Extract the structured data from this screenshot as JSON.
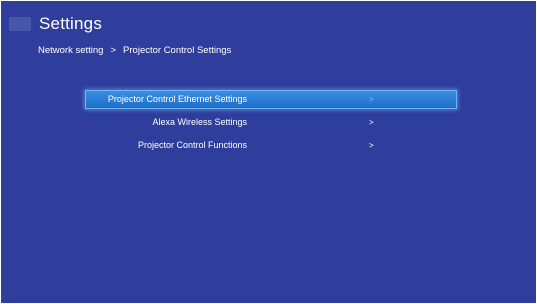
{
  "header": {
    "title": "Settings"
  },
  "breadcrumb": {
    "parent": "Network setting",
    "separator": ">",
    "current": "Projector Control Settings"
  },
  "menu": {
    "items": [
      {
        "label": "Projector Control Ethernet Settings",
        "arrow": ">",
        "selected": true
      },
      {
        "label": "Alexa Wireless Settings",
        "arrow": ">",
        "selected": false
      },
      {
        "label": "Projector Control Functions",
        "arrow": ">",
        "selected": false
      }
    ]
  },
  "colors": {
    "background": "#2f3e9c",
    "highlight": "#2f7fd8",
    "text": "#ffffff"
  }
}
